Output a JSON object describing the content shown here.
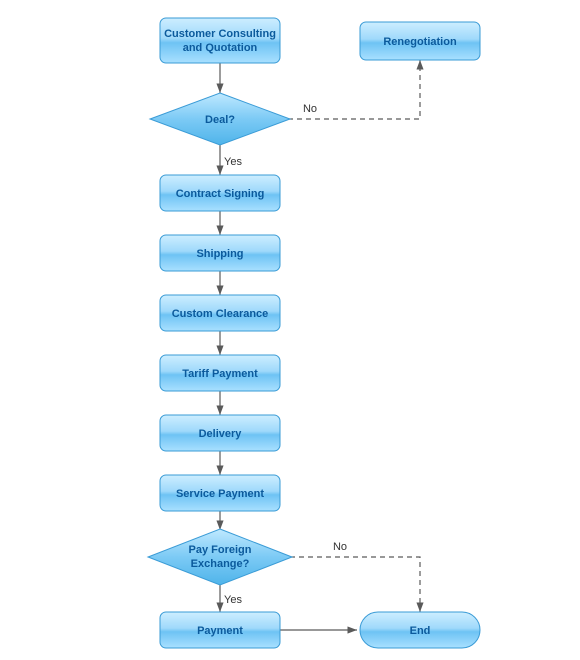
{
  "flowchart": {
    "nodes": {
      "customer_consulting": {
        "label_lines": [
          "Customer Consulting",
          "and Quotation"
        ]
      },
      "renegotiation": {
        "label": "Renegotiation"
      },
      "deal_decision": {
        "label": "Deal?"
      },
      "contract_signing": {
        "label": "Contract Signing"
      },
      "shipping": {
        "label": "Shipping"
      },
      "custom_clearance": {
        "label": "Custom Clearance"
      },
      "tariff_payment": {
        "label": "Tariff Payment"
      },
      "delivery": {
        "label": "Delivery"
      },
      "service_payment": {
        "label": "Service Payment"
      },
      "pay_fx_decision": {
        "label_lines": [
          "Pay Foreign",
          "Exchange?"
        ]
      },
      "payment": {
        "label": "Payment"
      },
      "end": {
        "label": "End"
      }
    },
    "edges": {
      "deal_yes": {
        "label": "Yes"
      },
      "deal_no": {
        "label": "No"
      },
      "payfx_yes": {
        "label": "Yes"
      },
      "payfx_no": {
        "label": "No"
      }
    }
  }
}
